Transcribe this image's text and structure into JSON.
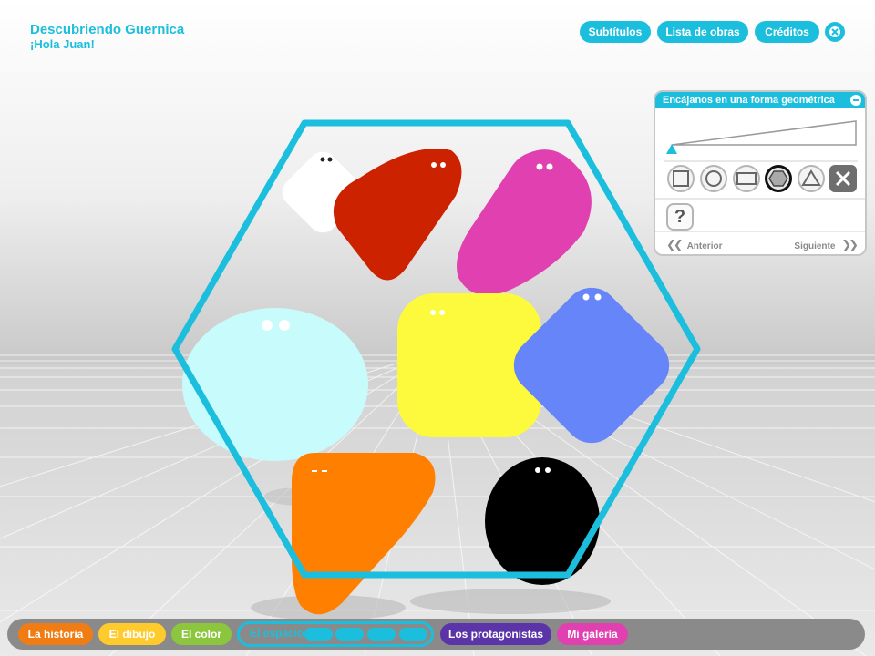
{
  "app": {
    "title": "Descubriendo Guernica",
    "greeting": "¡Hola Juan!"
  },
  "top_nav": {
    "subtitles": "Subtítulos",
    "works": "Lista de obras",
    "credits": "Créditos",
    "close_icon": "close-icon"
  },
  "panel": {
    "title": "Encájanos en una forma geométrica",
    "shapes": [
      "square",
      "circle",
      "rectangle",
      "hexagon",
      "triangle",
      "delete"
    ],
    "selected_shape": "hexagon",
    "help": "?",
    "prev": "Anterior",
    "next": "Siguiente"
  },
  "frame": {
    "shape": "hexagon",
    "color": "#1bbfdd"
  },
  "characters": [
    {
      "name": "white",
      "color": "#ffffff"
    },
    {
      "name": "red",
      "color": "#cc2200"
    },
    {
      "name": "magenta",
      "color": "#e040b0"
    },
    {
      "name": "light-cyan",
      "color": "#c8fbfb"
    },
    {
      "name": "yellow",
      "color": "#fdf93c"
    },
    {
      "name": "blue",
      "color": "#6585f8"
    },
    {
      "name": "orange",
      "color": "#ff8000"
    },
    {
      "name": "black",
      "color": "#000000"
    }
  ],
  "bottom_nav": {
    "tabs": [
      {
        "label": "La historia",
        "color": "#f07d14"
      },
      {
        "label": "El dibujo",
        "color": "#ffca2c"
      },
      {
        "label": "El color",
        "color": "#8cc63f"
      },
      {
        "label": "El espacio",
        "color": "#1bbfdd"
      },
      {
        "label": "Los protagonistas",
        "color": "#5b35a7"
      },
      {
        "label": "Mi galería",
        "color": "#e040b0"
      }
    ]
  }
}
